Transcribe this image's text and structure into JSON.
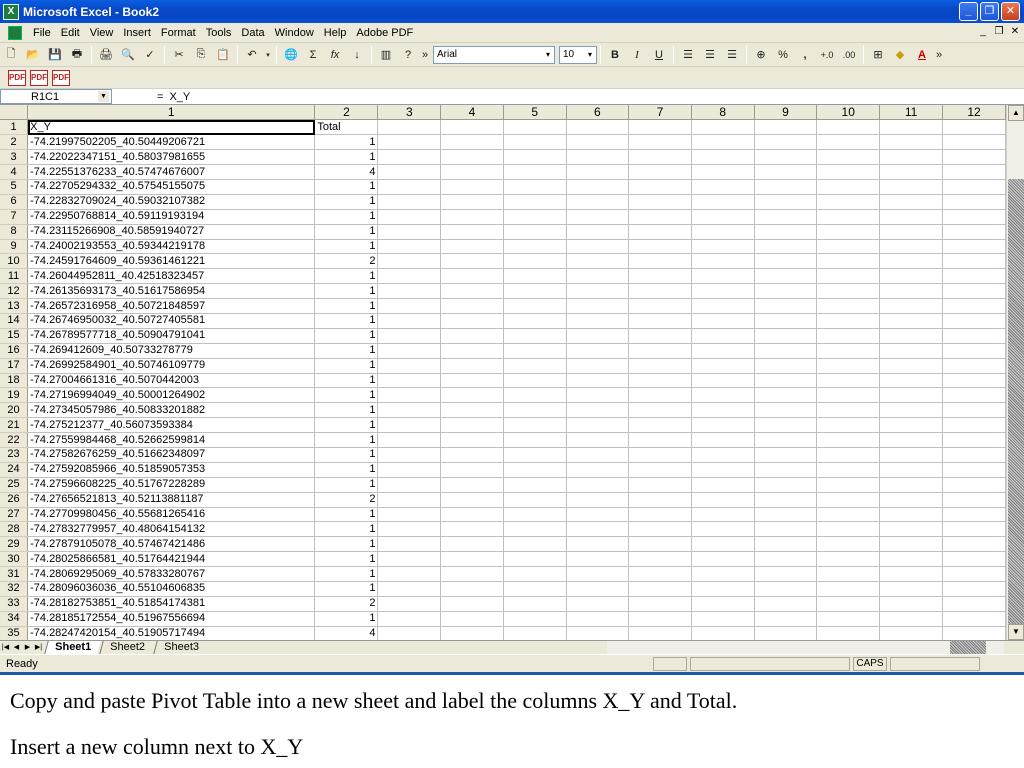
{
  "window": {
    "title": "Microsoft Excel - Book2",
    "app_icon": "excel-icon",
    "buttons": [
      "minimize",
      "restore",
      "close"
    ]
  },
  "menu": {
    "items": [
      {
        "label": "File",
        "accel": "F"
      },
      {
        "label": "Edit",
        "accel": "E"
      },
      {
        "label": "View",
        "accel": "V"
      },
      {
        "label": "Insert",
        "accel": "I"
      },
      {
        "label": "Format",
        "accel": "o"
      },
      {
        "label": "Tools",
        "accel": "T"
      },
      {
        "label": "Data",
        "accel": "D"
      },
      {
        "label": "Window",
        "accel": "W"
      },
      {
        "label": "Help",
        "accel": "H"
      },
      {
        "label": "Adobe PDF",
        "accel": "b"
      }
    ]
  },
  "toolbar": {
    "font_name": "Arial",
    "font_size": "10",
    "bold": "B",
    "italic": "I",
    "underline": "U"
  },
  "formula_bar": {
    "name_box": "R1C1",
    "equals": "=",
    "content": "X_Y"
  },
  "columns": [
    "1",
    "2",
    "3",
    "4",
    "5",
    "6",
    "7",
    "8",
    "9",
    "10",
    "11",
    "12"
  ],
  "rows": [
    {
      "n": "1",
      "a": "X_Y",
      "b": "Total"
    },
    {
      "n": "2",
      "a": "-74.21997502205_40.50449206721",
      "b": "1"
    },
    {
      "n": "3",
      "a": "-74.22022347151_40.58037981655",
      "b": "1"
    },
    {
      "n": "4",
      "a": "-74.22551376233_40.57474676007",
      "b": "4"
    },
    {
      "n": "5",
      "a": "-74.22705294332_40.57545155075",
      "b": "1"
    },
    {
      "n": "6",
      "a": "-74.22832709024_40.59032107382",
      "b": "1"
    },
    {
      "n": "7",
      "a": "-74.22950768814_40.59119193194",
      "b": "1"
    },
    {
      "n": "8",
      "a": "-74.23115266908_40.58591940727",
      "b": "1"
    },
    {
      "n": "9",
      "a": "-74.24002193553_40.59344219178",
      "b": "1"
    },
    {
      "n": "10",
      "a": "-74.24591764609_40.59361461221",
      "b": "2"
    },
    {
      "n": "11",
      "a": "-74.26044952811_40.42518323457",
      "b": "1"
    },
    {
      "n": "12",
      "a": "-74.26135693173_40.51617586954",
      "b": "1"
    },
    {
      "n": "13",
      "a": "-74.26572316958_40.50721848597",
      "b": "1"
    },
    {
      "n": "14",
      "a": "-74.26746950032_40.50727405581",
      "b": "1"
    },
    {
      "n": "15",
      "a": "-74.26789577718_40.50904791041",
      "b": "1"
    },
    {
      "n": "16",
      "a": "-74.269412609_40.50733278779",
      "b": "1"
    },
    {
      "n": "17",
      "a": "-74.26992584901_40.50746109779",
      "b": "1"
    },
    {
      "n": "18",
      "a": "-74.27004661316_40.5070442003",
      "b": "1"
    },
    {
      "n": "19",
      "a": "-74.27196994049_40.50001264902",
      "b": "1"
    },
    {
      "n": "20",
      "a": "-74.27345057986_40.50833201882",
      "b": "1"
    },
    {
      "n": "21",
      "a": "-74.275212377_40.56073593384",
      "b": "1"
    },
    {
      "n": "22",
      "a": "-74.27559984468_40.52662599814",
      "b": "1"
    },
    {
      "n": "23",
      "a": "-74.27582676259_40.51662348097",
      "b": "1"
    },
    {
      "n": "24",
      "a": "-74.27592085966_40.51859057353",
      "b": "1"
    },
    {
      "n": "25",
      "a": "-74.27596608225_40.51767228289",
      "b": "1"
    },
    {
      "n": "26",
      "a": "-74.27656521813_40.52113881187",
      "b": "2"
    },
    {
      "n": "27",
      "a": "-74.27709980456_40.55681265416",
      "b": "1"
    },
    {
      "n": "28",
      "a": "-74.27832779957_40.48064154132",
      "b": "1"
    },
    {
      "n": "29",
      "a": "-74.27879105078_40.57467421486",
      "b": "1"
    },
    {
      "n": "30",
      "a": "-74.28025866581_40.51764421944",
      "b": "1"
    },
    {
      "n": "31",
      "a": "-74.28069295069_40.57833280767",
      "b": "1"
    },
    {
      "n": "32",
      "a": "-74.28096036036_40.55104606835",
      "b": "1"
    },
    {
      "n": "33",
      "a": "-74.28182753851_40.51854174381",
      "b": "2"
    },
    {
      "n": "34",
      "a": "-74.28185172554_40.51967556694",
      "b": "1"
    },
    {
      "n": "35",
      "a": "-74.28247420154_40.51905717494",
      "b": "4"
    }
  ],
  "sheet_tabs": [
    "Sheet1",
    "Sheet2",
    "Sheet3"
  ],
  "status": {
    "ready": "Ready",
    "caps": "CAPS"
  },
  "caption": {
    "line1": "Copy and paste Pivot Table into a new sheet and label the columns X_Y and Total.",
    "line2": "Insert a new column next to X_Y"
  }
}
